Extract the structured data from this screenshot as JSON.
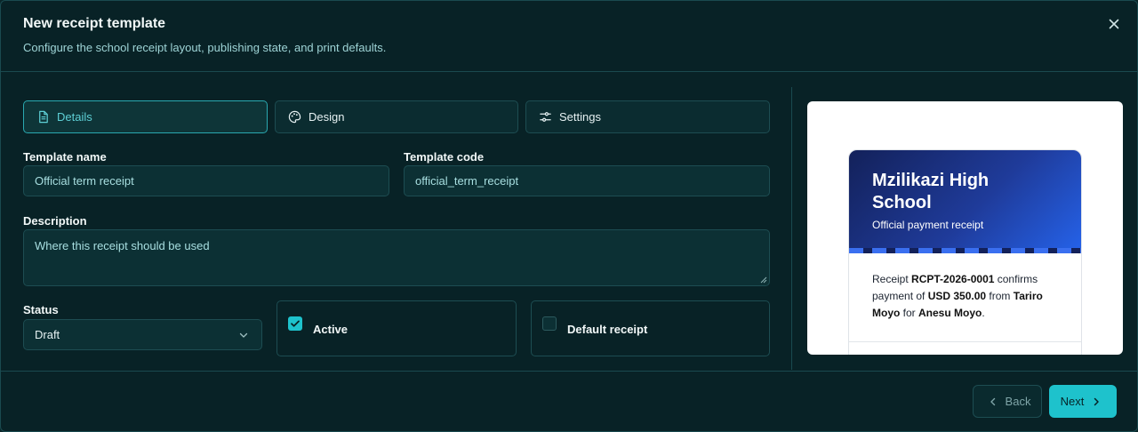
{
  "header": {
    "title": "New receipt template",
    "subtitle": "Configure the school receipt layout, publishing state, and print defaults."
  },
  "tabs": [
    {
      "label": "Details",
      "icon": "document-icon",
      "active": true
    },
    {
      "label": "Design",
      "icon": "palette-icon",
      "active": false
    },
    {
      "label": "Settings",
      "icon": "sliders-icon",
      "active": false
    }
  ],
  "form": {
    "template_name": {
      "label": "Template name",
      "value": "Official term receipt"
    },
    "template_code": {
      "label": "Template code",
      "value": "official_term_receipt"
    },
    "description": {
      "label": "Description",
      "placeholder": "Where this receipt should be used"
    },
    "status": {
      "label": "Status",
      "value": "Draft"
    },
    "active": {
      "label": "Active",
      "checked": true
    },
    "default_receipt": {
      "label": "Default receipt",
      "checked": false
    }
  },
  "preview": {
    "school": "Mzilikazi High School",
    "subtitle": "Official payment receipt",
    "text_1": "Receipt ",
    "receipt_no": "RCPT-2026-0001",
    "text_2": " confirms payment of ",
    "amount": "USD 350.00",
    "text_3": " from ",
    "payer": "Tariro Moyo",
    "text_4": " for ",
    "student": "Anesu Moyo",
    "text_5": "."
  },
  "footer": {
    "back_label": "Back",
    "next_label": "Next"
  },
  "colors": {
    "accent": "#1ec2cc",
    "background": "#082226",
    "receipt_header_start": "#13215a",
    "receipt_header_end": "#2563eb"
  }
}
